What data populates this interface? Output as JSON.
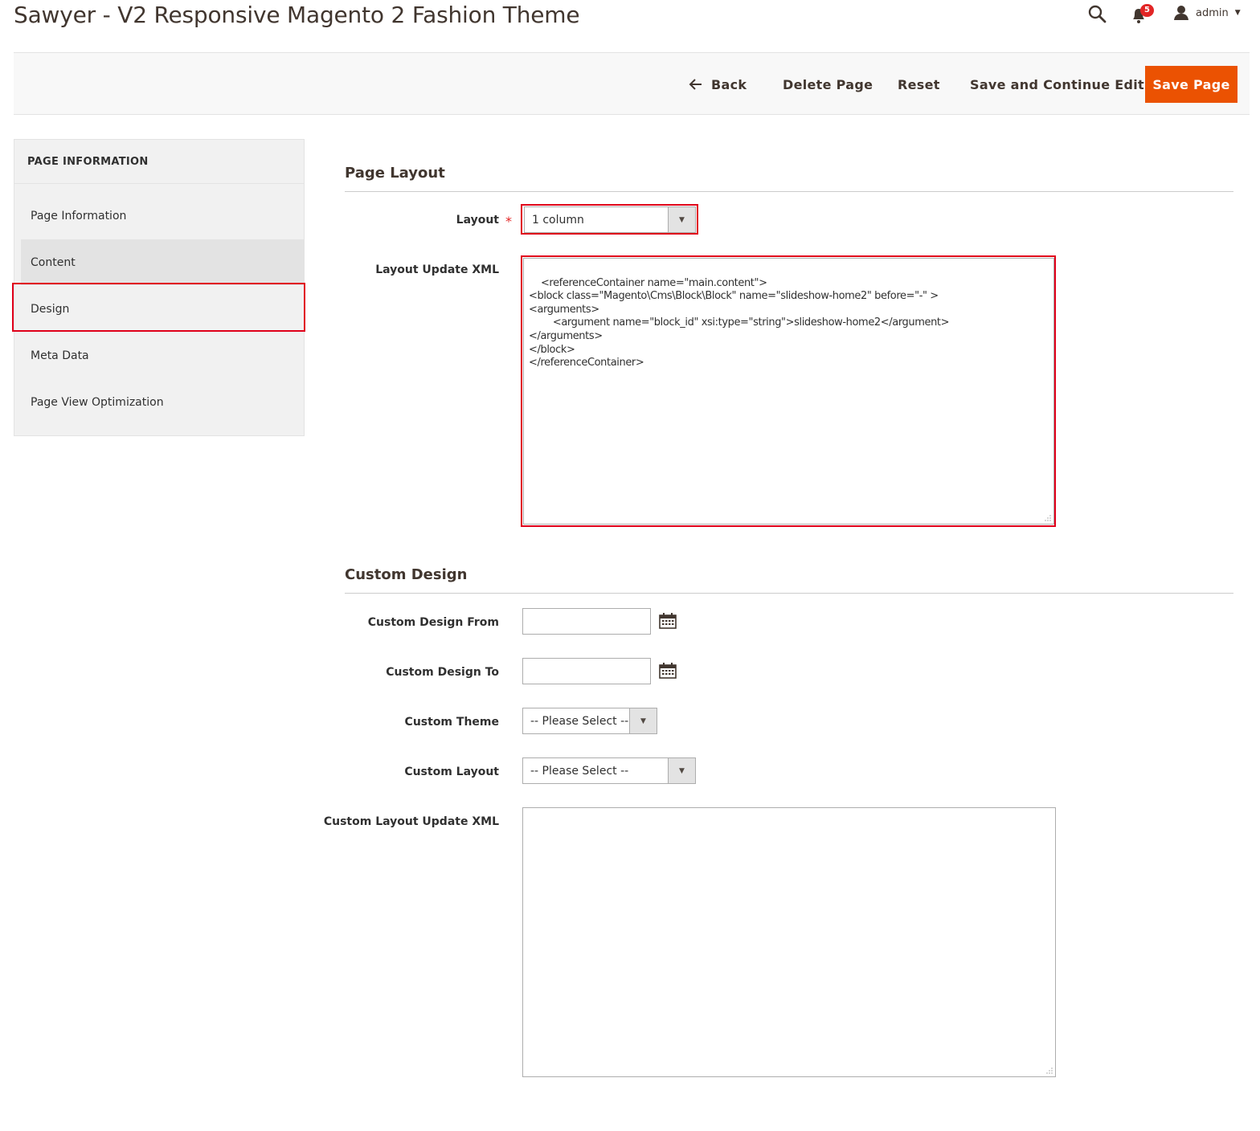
{
  "header": {
    "title": "Sawyer - V2 Responsive Magento 2 Fashion Theme",
    "notifications_count": "5",
    "user_name": "admin"
  },
  "action_bar": {
    "back_label": "Back",
    "delete_label": "Delete Page",
    "reset_label": "Reset",
    "save_continue_label": "Save and Continue Edit",
    "save_label": "Save Page"
  },
  "sidebar": {
    "title": "PAGE INFORMATION",
    "items": [
      {
        "label": "Page Information"
      },
      {
        "label": "Content"
      },
      {
        "label": "Design"
      },
      {
        "label": "Meta Data"
      },
      {
        "label": "Page View Optimization"
      }
    ]
  },
  "page_layout": {
    "title": "Page Layout",
    "layout_label": "Layout",
    "layout_value": "1 column",
    "xml_label": "Layout Update XML",
    "xml_value": "<referenceContainer name=\"main.content\">\n<block class=\"Magento\\Cms\\Block\\Block\" name=\"slideshow-home2\" before=\"-\" >\n<arguments>\n        <argument name=\"block_id\" xsi:type=\"string\">slideshow-home2</argument>\n</arguments>\n</block>\n</referenceContainer>"
  },
  "custom_design": {
    "title": "Custom Design",
    "from_label": "Custom Design From",
    "from_value": "",
    "to_label": "Custom Design To",
    "to_value": "",
    "theme_label": "Custom Theme",
    "theme_value": "-- Please Select --",
    "layout_label": "Custom Layout",
    "layout_value": "-- Please Select --",
    "xml_label": "Custom Layout Update XML",
    "xml_value": ""
  },
  "colors": {
    "accent": "#eb5202",
    "highlight": "#e0001a",
    "badge": "#e22626"
  }
}
